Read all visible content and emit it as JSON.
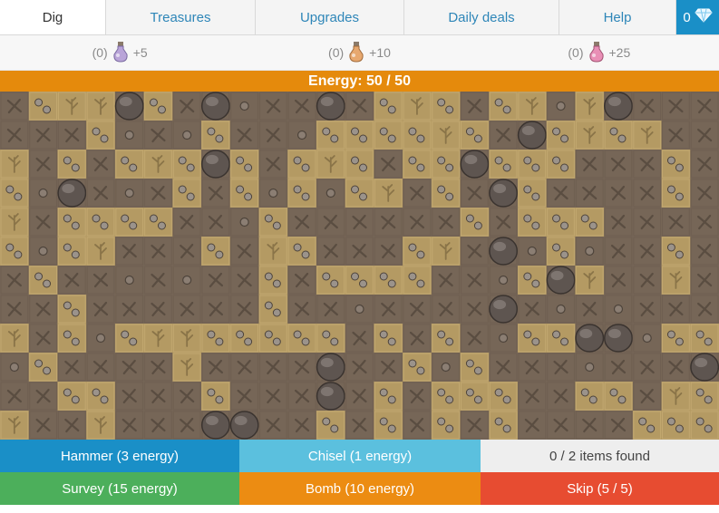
{
  "tabs": {
    "dig": "Dig",
    "treasures": "Treasures",
    "upgrades": "Upgrades",
    "daily_deals": "Daily deals",
    "help": "Help",
    "gems": "0"
  },
  "potions": [
    {
      "count": "(0)",
      "bonus": "+5",
      "color": "#b9a4d8"
    },
    {
      "count": "(0)",
      "bonus": "+10",
      "color": "#e7a86f"
    },
    {
      "count": "(0)",
      "bonus": "+25",
      "color": "#e98fb6"
    }
  ],
  "energy": {
    "label": "Energy: 50 / 50",
    "current": 50,
    "max": 50
  },
  "actions": {
    "hammer": "Hammer (3 energy)",
    "chisel": "Chisel (1 energy)",
    "items_found": "0 / 2 items found",
    "survey": "Survey (15 energy)",
    "bomb": "Bomb (10 energy)",
    "skip": "Skip (5 / 5)"
  },
  "colors": {
    "dirt": "#766657",
    "sand": "#b49a63",
    "accent": "#1a8fc7",
    "energy": "#e58a0c"
  },
  "grid": {
    "cols": 25,
    "rows": 12,
    "tile_legend": {
      "d": "dirt-pebble",
      "x": "dirt-crack",
      "s": "sand-pebbles",
      "f": "sand-fossil",
      "r": "boulder"
    },
    "tiles": [
      "xsffrsxrdxxrxsfsxsfdfrxxx",
      "xxxsdxdsxxdssssfsxrsfsfxx",
      "fxsxsfsrsxsfsxssrsssxxxsx",
      "sdrxdxsxsdsdsfxsxrsxxxxsx",
      "fxssssxxdsxxxxxxsxsssxxxx",
      "sdsfxxxsxfsxxxsfxrdsdxxsx",
      "xsxxdxdxxsxssssxxdsrfxxfx",
      "xxsxxxxxxsxxdxxxxrxdxdxxx",
      "fxsdsffsssssxsxsxdssrrdssr",
      "dsxxxxfxxxxrxxsdsxxxdxxxr",
      "xxssxxxsxxxrxsxsssxxssxfs",
      "fxxfxxxrrxxsxsxsxsxxxxsss"
    ]
  }
}
